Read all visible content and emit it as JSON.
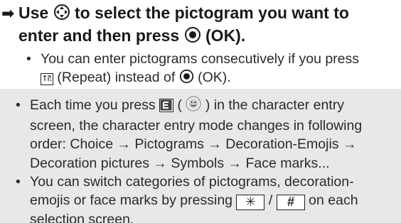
{
  "step": {
    "arrow": "➡",
    "line1_a": "Use",
    "line1_b": "to select the pictogram you want to",
    "line2_a": "enter and then press",
    "line2_b": "(OK).",
    "icons": {
      "nav": "navigation-key-icon",
      "ok": "center-ok-key-icon"
    }
  },
  "sub_note": {
    "bullet": "•",
    "line1": "You can enter pictograms consecutively if you press",
    "line2_a": "(Repeat) instead of",
    "line2_b": "(OK).",
    "icons": {
      "repeat": "repeat-softkey-icon",
      "ok": "center-ok-key-icon"
    }
  },
  "notes": {
    "bullet": "•",
    "item1": {
      "line1_a": "Each time you press",
      "line1_b": "(",
      "line1_c": ") in the character entry",
      "line2": "screen, the character entry mode changes in following",
      "line3": "order: Choice → Pictograms → Decoration-Emojis →",
      "line4": "Decoration pictures → Symbols → Face marks...",
      "icons": {
        "key": "emoji-key-icon",
        "face": "smiley-face-icon"
      }
    },
    "item2": {
      "line1": "You can switch categories of pictograms, decoration-",
      "line2_a": "emojis or face marks by pressing",
      "line2_sep": "/",
      "line2_b": "on each",
      "line3": "selection screen.",
      "keys": {
        "asterisk": "✳",
        "hash": "#"
      }
    }
  }
}
